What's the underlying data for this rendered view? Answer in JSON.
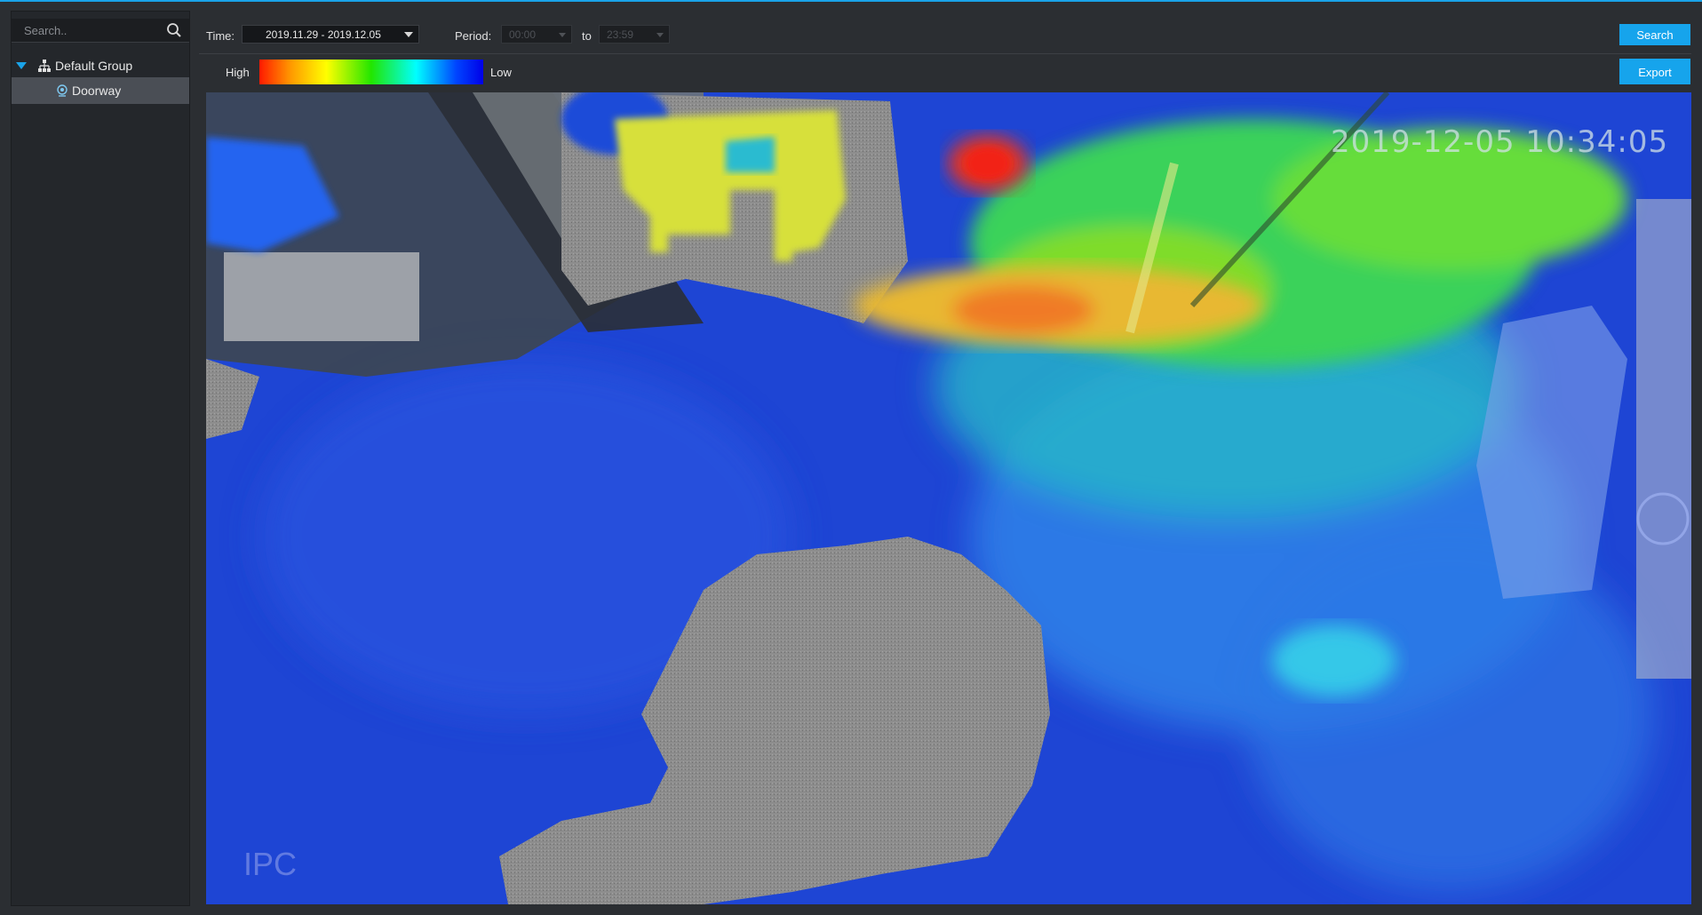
{
  "sidebar": {
    "search": {
      "placeholder": "Search.."
    },
    "group": {
      "label": "Default Group"
    },
    "device": {
      "label": "Doorway"
    }
  },
  "toolbar": {
    "time_label": "Time:",
    "date_range": "2019.11.29 - 2019.12.05",
    "period_label": "Period:",
    "start_time": "00:00",
    "to_label": "to",
    "end_time": "23:59",
    "search_button": "Search"
  },
  "legend": {
    "high_label": "High",
    "low_label": "Low",
    "export_button": "Export"
  },
  "heatmap": {
    "timestamp": "2019-12-05 10:34:05",
    "watermark": "IPC",
    "colors": {
      "low": "#1e45d4",
      "mid": "#2bd36b",
      "high": "#e8e040",
      "hot": "#f03a20",
      "floor": "#8d8d8d"
    }
  },
  "accent_color": "#16a4ec"
}
